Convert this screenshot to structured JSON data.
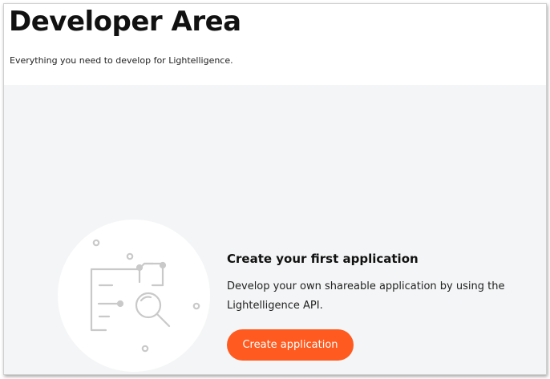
{
  "header": {
    "title": "Developer Area",
    "subtitle": "Everything you need to develop for Lightelligence."
  },
  "empty_state": {
    "title": "Create your first application",
    "description": "Develop your own shareable application by using the Lightelligence API.",
    "button_label": "Create application",
    "illustration_icon": "folder-search-icon"
  },
  "colors": {
    "accent": "#ff5a1f",
    "content_background": "#f4f5f6",
    "illustration_stroke": "#c9c9c9"
  }
}
